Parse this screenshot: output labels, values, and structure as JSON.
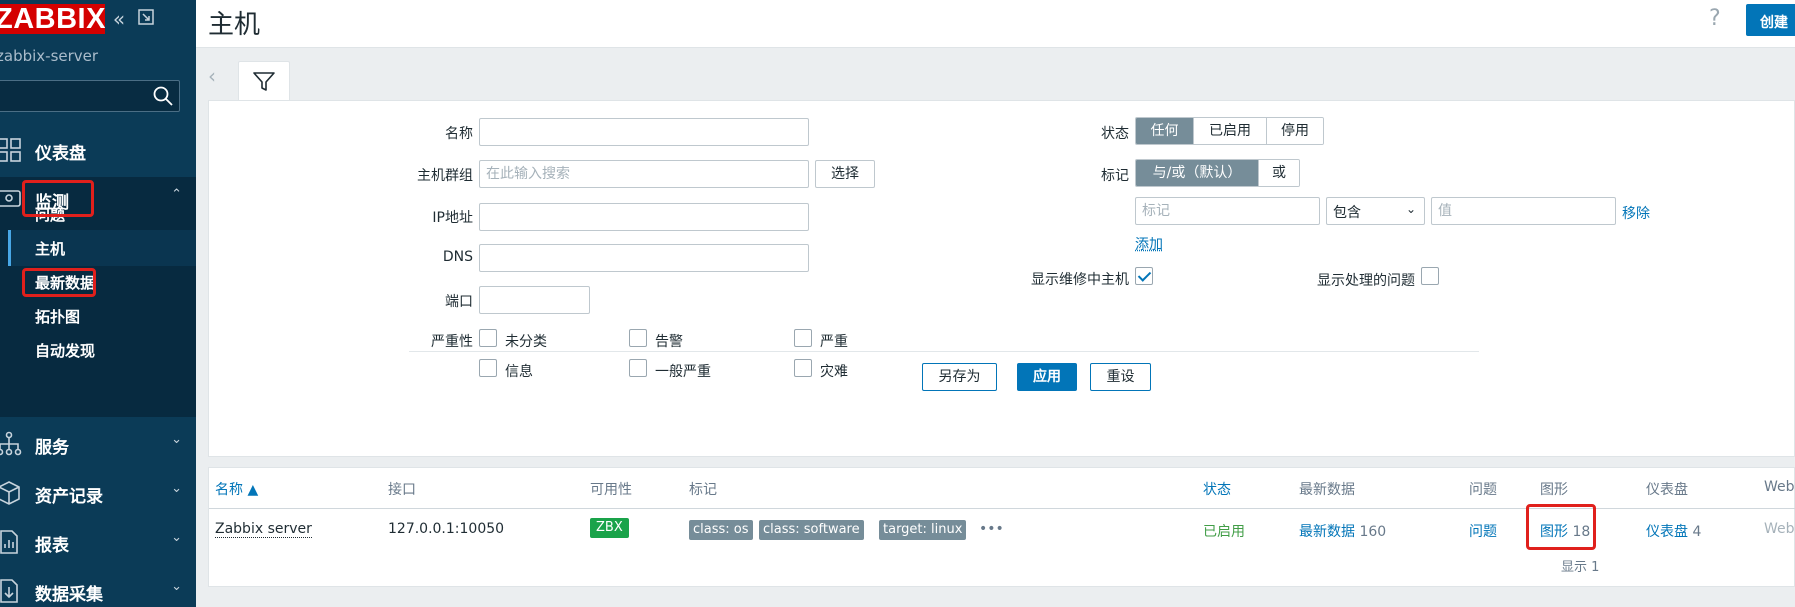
{
  "sidebar": {
    "logo": "ZABBIX",
    "server": "zabbix-server",
    "search_placeholder": "",
    "nav": [
      {
        "label": "仪表盘"
      },
      {
        "label": "监测"
      },
      {
        "label": "服务"
      },
      {
        "label": "资产记录"
      },
      {
        "label": "报表"
      },
      {
        "label": "数据采集"
      }
    ],
    "monitoring_sub": [
      {
        "label": "问题"
      },
      {
        "label": "主机"
      },
      {
        "label": "最新数据"
      },
      {
        "label": "拓扑图"
      },
      {
        "label": "自动发现"
      }
    ]
  },
  "header": {
    "title": "主机",
    "help": "?",
    "create_button": "创建"
  },
  "filter": {
    "name_label": "名称",
    "name_value": "",
    "hostgroup_label": "主机群组",
    "hostgroup_placeholder": "在此输入搜索",
    "select_button": "选择",
    "ip_label": "IP地址",
    "ip_value": "",
    "dns_label": "DNS",
    "dns_value": "",
    "port_label": "端口",
    "port_value": "",
    "severity_label": "严重性",
    "severities": [
      "未分类",
      "告警",
      "严重",
      "信息",
      "一般严重",
      "灾难"
    ],
    "status_label": "状态",
    "status_options": [
      "任何",
      "已启用",
      "停用"
    ],
    "status_selected": "任何",
    "tags_label": "标记",
    "tags_mode_options": [
      "与/或（默认）",
      "或"
    ],
    "tags_mode_selected": "与/或（默认）",
    "tag_placeholder": "标记",
    "tag_operator": "包含",
    "tag_value_placeholder": "值",
    "remove_link": "移除",
    "add_link": "添加",
    "show_maintenance_label": "显示维修中主机",
    "show_maintenance_checked": true,
    "show_suppressed_label": "显示处理的问题",
    "show_suppressed_checked": false,
    "save_as_button": "另存为",
    "apply_button": "应用",
    "reset_button": "重设"
  },
  "table": {
    "columns": [
      "名称 ▲",
      "接口",
      "可用性",
      "标记",
      "状态",
      "最新数据",
      "问题",
      "图形",
      "仪表盘",
      "Web"
    ],
    "rows": [
      {
        "name": "Zabbix server",
        "interface": "127.0.0.1:10050",
        "availability": "ZBX",
        "tags": [
          "class: os",
          "class: software",
          "target: linux"
        ],
        "more": "•••",
        "status": "已启用",
        "latest_data_label": "最新数据",
        "latest_data_count": "160",
        "problems": "问题",
        "graphs_label": "图形",
        "graphs_count": "18",
        "dashboards_label": "仪表盘",
        "dashboards_count": "4",
        "web": "Web"
      }
    ],
    "footer": "显示 1"
  },
  "colors": {
    "sidebar_bg": "#0b3b57",
    "accent": "#0275b8",
    "logo": "#d40000",
    "highlight_box": "#e0201c",
    "status_enabled": "#429e47",
    "zbx_badge": "#1aa34a"
  }
}
